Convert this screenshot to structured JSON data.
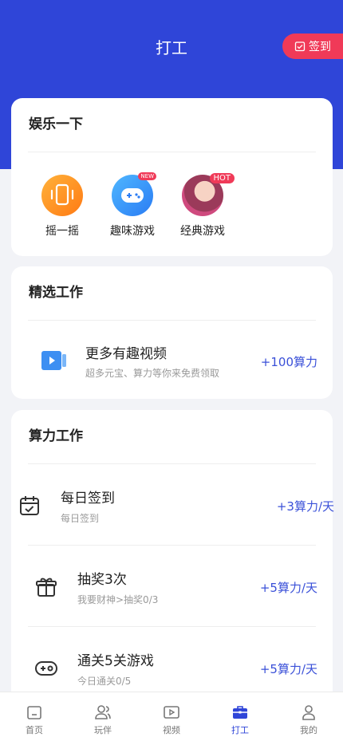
{
  "header": {
    "title": "打工",
    "signin_label": "签到"
  },
  "entertainment": {
    "heading": "娱乐一下",
    "games": [
      {
        "label": "摇一摇",
        "icon": "phone-shake-icon"
      },
      {
        "label": "趣味游戏",
        "icon": "gamepad-icon",
        "badge": "NEW"
      },
      {
        "label": "经典游戏",
        "icon": "anime-girl-avatar",
        "badge": "HOT"
      }
    ]
  },
  "featured": {
    "heading": "精选工作",
    "item": {
      "title": "更多有趣视频",
      "subtitle": "超多元宝、算力等你来免费领取",
      "reward": "+100算力",
      "icon": "video-icon"
    }
  },
  "compute_work": {
    "heading": "算力工作",
    "tasks": [
      {
        "title": "每日签到",
        "subtitle": "每日签到",
        "reward": "+3算力/天",
        "icon": "calendar-check-icon"
      },
      {
        "title": "抽奖3次",
        "subtitle": "我要财神>抽奖0/3",
        "reward": "+5算力/天",
        "icon": "gift-icon"
      },
      {
        "title": "通关5关游戏",
        "subtitle": "今日通关0/5",
        "reward": "+5算力/天",
        "icon": "gamepad-outline-icon"
      }
    ]
  },
  "tabbar": {
    "tabs": [
      {
        "label": "首页",
        "icon": "home-icon"
      },
      {
        "label": "玩伴",
        "icon": "friends-icon"
      },
      {
        "label": "视频",
        "icon": "video-play-icon"
      },
      {
        "label": "打工",
        "icon": "briefcase-icon",
        "active": true
      },
      {
        "label": "我的",
        "icon": "user-icon"
      }
    ]
  },
  "colors": {
    "primary": "#2f45d8",
    "accent": "#f03a58",
    "reward": "#3a50d8"
  }
}
